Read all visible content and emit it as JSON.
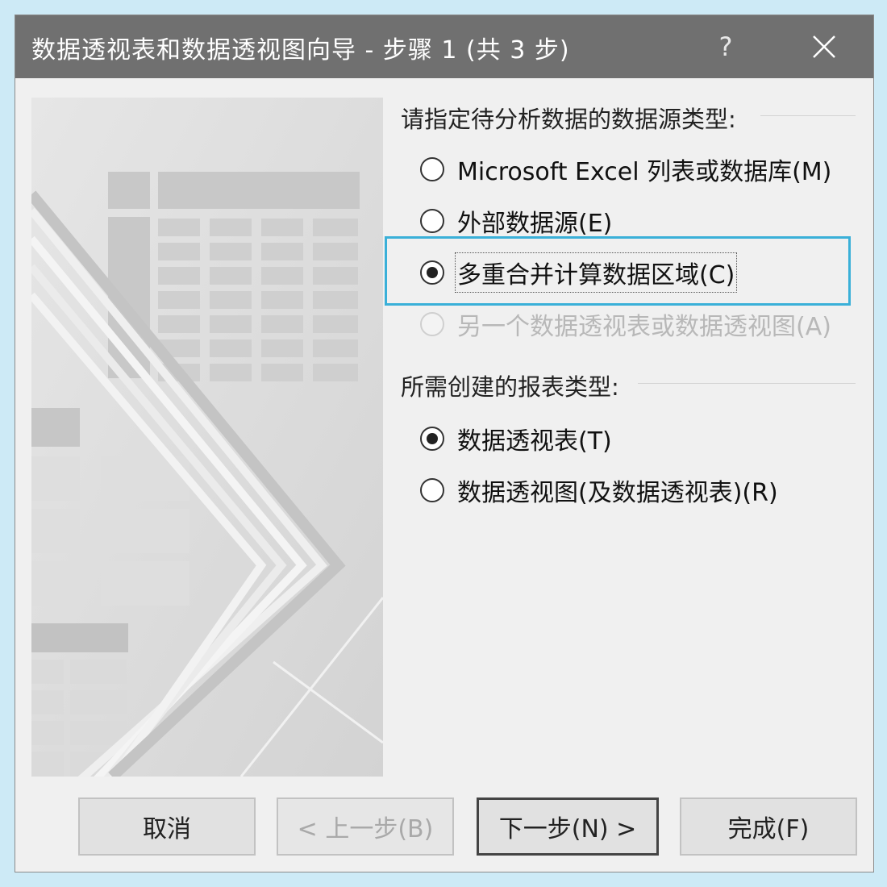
{
  "window": {
    "title": "数据透视表和数据透视图向导 - 步骤 1 (共 3 步)",
    "help_label": "?"
  },
  "data_source": {
    "heading": "请指定待分析数据的数据源类型:",
    "options": [
      {
        "label": "Microsoft Excel 列表或数据库(M)",
        "checked": false,
        "disabled": false
      },
      {
        "label": "外部数据源(E)",
        "checked": false,
        "disabled": false
      },
      {
        "label": "多重合并计算数据区域(C)",
        "checked": true,
        "disabled": false
      },
      {
        "label": "另一个数据透视表或数据透视图(A)",
        "checked": false,
        "disabled": true
      }
    ]
  },
  "report_type": {
    "heading": "所需创建的报表类型:",
    "options": [
      {
        "label": "数据透视表(T)",
        "checked": true
      },
      {
        "label": "数据透视图(及数据透视表)(R)",
        "checked": false
      }
    ]
  },
  "buttons": {
    "cancel": "取消",
    "back": "< 上一步(B)",
    "next": "下一步(N) >",
    "finish": "完成(F)"
  },
  "colors": {
    "titlebar": "#707070",
    "focus": "#3ab0d8",
    "background": "#cdeaf6"
  }
}
